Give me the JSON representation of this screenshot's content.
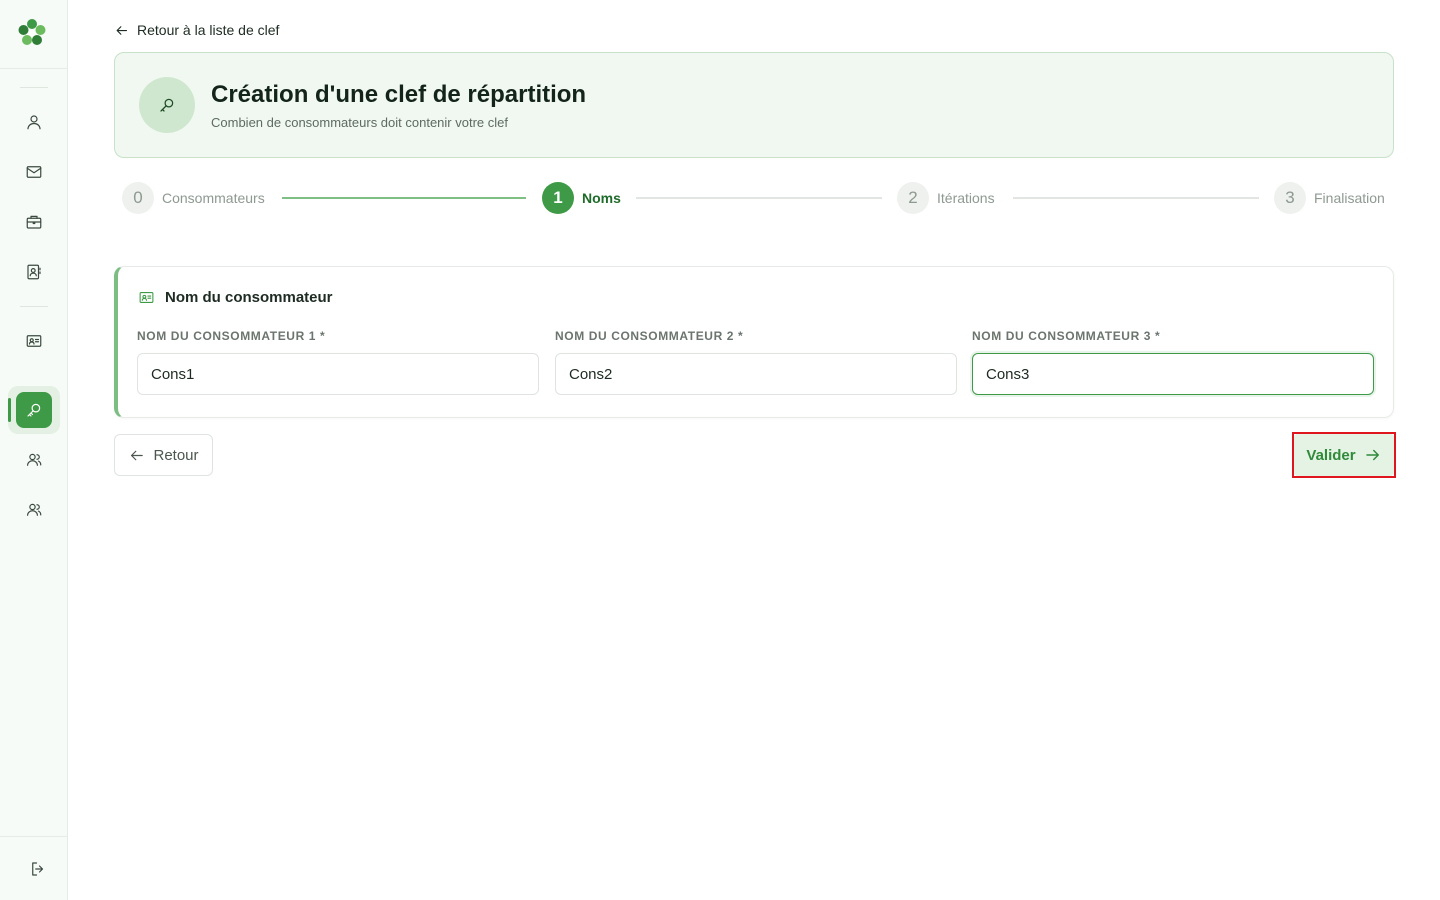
{
  "nav": {
    "back_link": "Retour à la liste de clef"
  },
  "header": {
    "title": "Création d'une clef de répartition",
    "subtitle": "Combien de consommateurs doit contenir votre clef",
    "icon": "key-icon"
  },
  "stepper": {
    "steps": [
      {
        "number": "0",
        "label": "Consommateurs",
        "state": "done"
      },
      {
        "number": "1",
        "label": "Noms",
        "state": "active"
      },
      {
        "number": "2",
        "label": "Itérations",
        "state": "pending"
      },
      {
        "number": "3",
        "label": "Finalisation",
        "state": "pending"
      }
    ]
  },
  "form": {
    "title": "Nom du consommateur",
    "fields": [
      {
        "label": "NOM DU CONSOMMATEUR 1 *",
        "value": "Cons1"
      },
      {
        "label": "NOM DU CONSOMMATEUR 2 *",
        "value": "Cons2"
      },
      {
        "label": "NOM DU CONSOMMATEUR 3 *",
        "value": "Cons3"
      }
    ]
  },
  "actions": {
    "back_label": "Retour",
    "validate_label": "Valider"
  },
  "sidebar": {
    "items": [
      {
        "icon": "user-icon"
      },
      {
        "icon": "mail-icon"
      },
      {
        "icon": "briefcase-icon"
      },
      {
        "icon": "contact-book-icon"
      },
      {
        "icon": "id-card-icon"
      },
      {
        "icon": "key-icon",
        "active": true
      },
      {
        "icon": "users-icon"
      },
      {
        "icon": "users-icon"
      },
      {
        "icon": "logout-icon"
      }
    ]
  },
  "colors": {
    "accent": "#3e9a46",
    "accent_light": "#e5f3e5",
    "highlight": "#e0161e"
  }
}
